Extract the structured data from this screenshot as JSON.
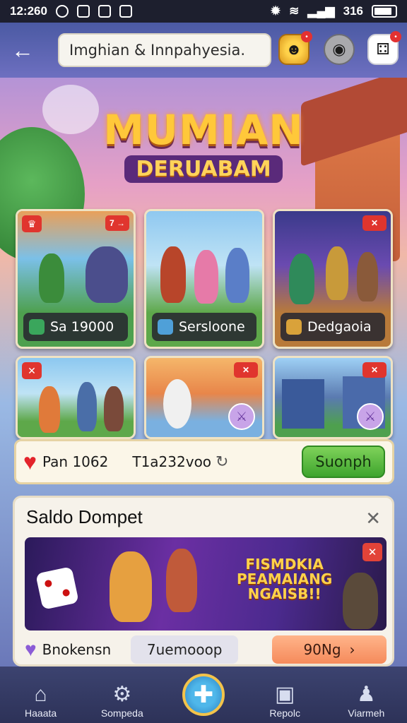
{
  "status_bar": {
    "time": "12:260",
    "network": "316"
  },
  "search": {
    "placeholder": "Imghian & Innpahyesia."
  },
  "hero": {
    "title": "MUMIAN",
    "subtitle": "DERUABAM"
  },
  "cards": [
    {
      "label": "Sa 19000",
      "badge": "7 →",
      "icon_color": "#3aa65c"
    },
    {
      "label": "Sersloone",
      "icon_color": "#4fa0d8"
    },
    {
      "label": "Dedgaoia",
      "badge": "✕",
      "icon_color": "#d9a23a"
    },
    {
      "badge": "✕"
    },
    {
      "badge": "✕"
    },
    {
      "badge": "✕"
    }
  ],
  "stats": {
    "value_1": "Pan 1062",
    "value_2": "T1a232voo",
    "button": "Suonph"
  },
  "wallet": {
    "title": "Saldo Dompet",
    "promo_line_1": "FISMDKIA",
    "promo_line_2": "PEAMAIANG",
    "promo_line_3": "NGAISB!!",
    "name": "Bnokensn",
    "input_value": "7uemooop",
    "button": "90Ng"
  },
  "nav": [
    {
      "label": "Haaata",
      "icon": "home-icon"
    },
    {
      "label": "Sompeda",
      "icon": "gear-icon"
    },
    {
      "label": "",
      "icon": "plus-icon"
    },
    {
      "label": "Repolc",
      "icon": "wallet-icon"
    },
    {
      "label": "Viarmeh",
      "icon": "profile-icon"
    }
  ]
}
